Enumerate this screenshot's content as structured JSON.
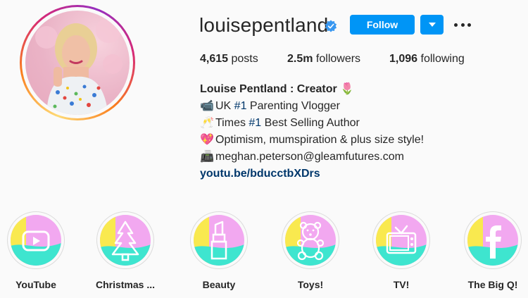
{
  "profile": {
    "username": "louisepentland",
    "verified": true,
    "follow_label": "Follow",
    "stats": {
      "posts_count": "4,615",
      "posts_label": "posts",
      "followers_count": "2.5m",
      "followers_label": "followers",
      "following_count": "1,096",
      "following_label": "following"
    },
    "bio": {
      "name_line": "Louise Pentland : Creator",
      "line1_pre": "UK ",
      "line1_tag": "#1",
      "line1_post": " Parenting Vlogger",
      "line2_pre": "Times ",
      "line2_tag": "#1",
      "line2_post": " Best Selling Author",
      "line3": "Optimism, mumspiration & plus size style!",
      "line4": "meghan.peterson@gleamfutures.com",
      "link": "youtu.be/bducctbXDrs"
    },
    "emojis": {
      "name": "🌷",
      "line1": "📹",
      "line2": "🥂",
      "line3": "💖",
      "line4": "📠"
    }
  },
  "highlights": [
    {
      "label": "YouTube",
      "icon": "youtube-icon"
    },
    {
      "label": "Christmas ...",
      "icon": "christmas-tree-icon"
    },
    {
      "label": "Beauty",
      "icon": "lipstick-icon"
    },
    {
      "label": "Toys!",
      "icon": "teddy-bear-icon"
    },
    {
      "label": "TV!",
      "icon": "tv-icon"
    },
    {
      "label": "The Big Q!",
      "icon": "facebook-icon"
    }
  ],
  "colors": {
    "follow_blue": "#0095f6",
    "link_blue": "#00376b",
    "highlight_pink": "#f2a8f0",
    "highlight_yellow": "#f9e94f",
    "highlight_teal": "#3ee5cf"
  }
}
